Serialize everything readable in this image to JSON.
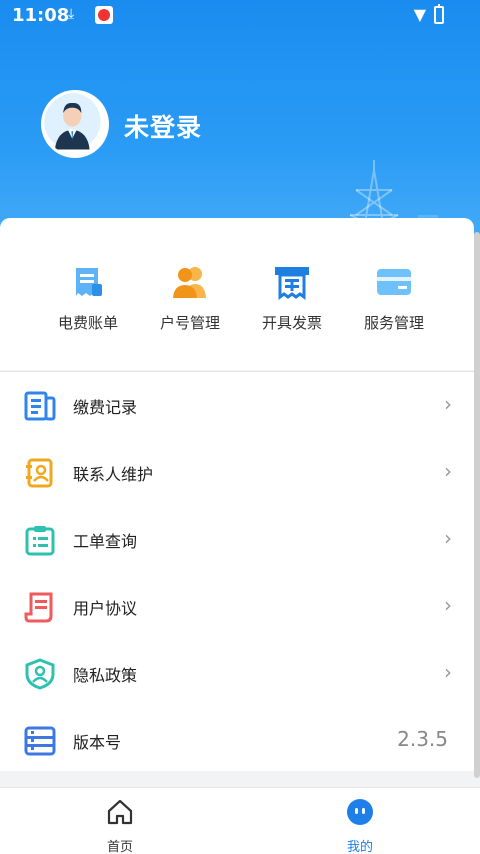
{
  "status_bar": {
    "time": "11:08",
    "download_icon": "download-arrow-icon",
    "app_icon": "app-notification-icon",
    "wifi_icon": "wifi-icon",
    "battery_icon": "battery-charging-icon"
  },
  "profile": {
    "login_status": "未登录",
    "avatar_icon": "user-avatar-icon"
  },
  "quick_actions": [
    {
      "label": "电费账单",
      "icon": "bill-icon",
      "color": "#3aa0f0"
    },
    {
      "label": "户号管理",
      "icon": "users-icon",
      "color": "#f5a21b"
    },
    {
      "label": "开具发票",
      "icon": "invoice-icon",
      "color": "#1f7fe0"
    },
    {
      "label": "服务管理",
      "icon": "card-icon",
      "color": "#3aa0f0"
    }
  ],
  "menu": [
    {
      "label": "缴费记录",
      "icon": "payment-record-icon",
      "color": "#2f86e8",
      "chevron": "›"
    },
    {
      "label": "联系人维护",
      "icon": "contacts-icon",
      "color": "#f0a81e",
      "chevron": "›"
    },
    {
      "label": "工单查询",
      "icon": "clipboard-icon",
      "color": "#2ec1b0",
      "chevron": "›"
    },
    {
      "label": "用户协议",
      "icon": "agreement-icon",
      "color": "#ef5a5a",
      "chevron": "›"
    },
    {
      "label": "隐私政策",
      "icon": "privacy-shield-icon",
      "color": "#2ec1b0",
      "chevron": "›"
    },
    {
      "label": "版本号",
      "icon": "version-icon",
      "color": "#3d78e0",
      "value": "2.3.5"
    }
  ],
  "bottom_nav": [
    {
      "label": "首页",
      "icon": "home-icon",
      "active": false,
      "color": "#333333"
    },
    {
      "label": "我的",
      "icon": "my-face-icon",
      "active": true,
      "color": "#1e7fe8"
    }
  ]
}
